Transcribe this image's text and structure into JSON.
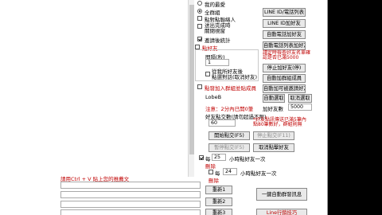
{
  "left": {
    "hint": "請用Ctrl + V 貼上您的推薦文"
  },
  "options": {
    "radio_top": "我的最愛",
    "radio_all": "全群組",
    "chk_single": "點對點聯絡人",
    "chk_read": "送出完成時\n關閉視窗",
    "chk_tally": "邀請後統計"
  },
  "addfriend": {
    "title": "點好友",
    "interval_label": "間隔(秒)",
    "interval_value": "1",
    "chk_stop": "從我所好友後\n點選對話(取消好友)",
    "chk_groups": "點發加入群組並貼成員"
  },
  "right_buttons": {
    "b1": "LINE ID/電話列表",
    "b2": "LINE ID加好友",
    "b3": "自動電話加好友",
    "b4": "自動電話列表加好友",
    "b5": "自動加好友(停)",
    "note": "請定時檢查好友名單確\n認是否已滿5000",
    "b6": "停止加好友(停)",
    "b7": "自動加群組成員",
    "b8": "自動加可被邀請好友"
  },
  "lower": {
    "lobe_title": "LobeB",
    "auto_label": "自動選取",
    "cancel_label": "取消選取",
    "note": "注意：2分內已開0筆",
    "add_count_label": "加好友數",
    "add_count_value": "5000",
    "add_people_label": "好友點交數(請勿超過不限)",
    "add_people_value": "60",
    "red_note": "*好友點訊傳送已滿5筆內\n點80筆數好，群組則無",
    "start_btn": "開始點交(F5)",
    "stop_btn": "停止點交(F11)",
    "pause_btn": "暫停點交(F5)",
    "cancel_group_btn": "取消點擊好友",
    "chk_every_label": "每",
    "every_value": "25",
    "every_unit": "小時點好友一次",
    "action_a": "刪除",
    "chk_every2_label": "每",
    "every2_value": "24",
    "every2_unit": "小時點好友一次",
    "action_b": "刪除"
  },
  "bottom_buttons": {
    "d1": "重新1",
    "d2": "重新2",
    "d3": "重新3",
    "send_group": "一鍵自動群發訊息",
    "line_tips": "Line行銷技巧"
  }
}
